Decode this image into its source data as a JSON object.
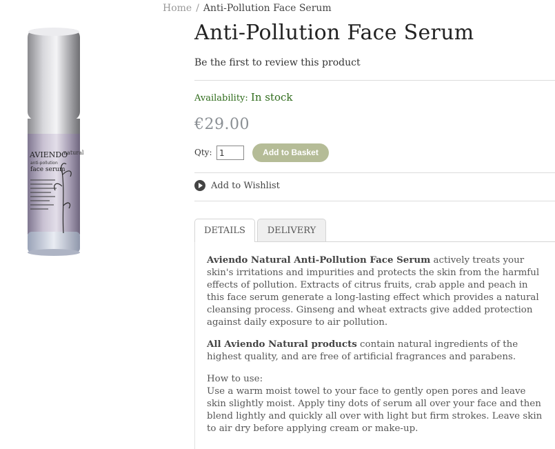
{
  "breadcrumb": {
    "home": "Home",
    "separator": "/",
    "current": "Anti-Pollution Face Serum"
  },
  "product": {
    "title": "Anti-Pollution Face Serum",
    "review_link": "Be the first to review this product",
    "availability_label": "Availability:",
    "availability_value": "In stock",
    "price": "€29.00",
    "qty_label": "Qty:",
    "qty_value": "1",
    "add_button": "Add to Basket",
    "wishlist": "Add to Wishlist",
    "image_alt": "Aviendo Natural anti-pollution face serum bottle",
    "bottle_brand": "AVIENDO",
    "bottle_sub": "natural",
    "bottle_line": "anti-pollution",
    "bottle_name": "face serum"
  },
  "tabs": [
    {
      "label": "DETAILS"
    },
    {
      "label": "DELIVERY"
    }
  ],
  "details": {
    "p1_bold": "Aviendo Natural Anti-Pollution Face Serum",
    "p1_rest": " actively treats your skin's irritations and impurities and protects the skin from the harmful effects of pollution. Extracts of citrus fruits, crab apple and peach in this face serum generate a long-lasting effect which provides a natural cleansing process. Ginseng and wheat extracts give added protection against daily exposure to air pollution.",
    "p2_bold": "All Aviendo Natural products",
    "p2_rest": " contain natural ingredients of the highest quality, and are free of artificial fragrances and parabens.",
    "howto_heading": "How to use:",
    "howto_text": "Use a warm moist towel to your face to gently open pores and leave skin slightly moist. Apply tiny dots of serum all over your face and then blend lightly and quickly all over with light but firm strokes. Leave skin to air dry before applying cream or make-up."
  },
  "colors": {
    "button": "#b5bc97",
    "availability": "#2e6b1a",
    "price": "#8a8f94"
  }
}
